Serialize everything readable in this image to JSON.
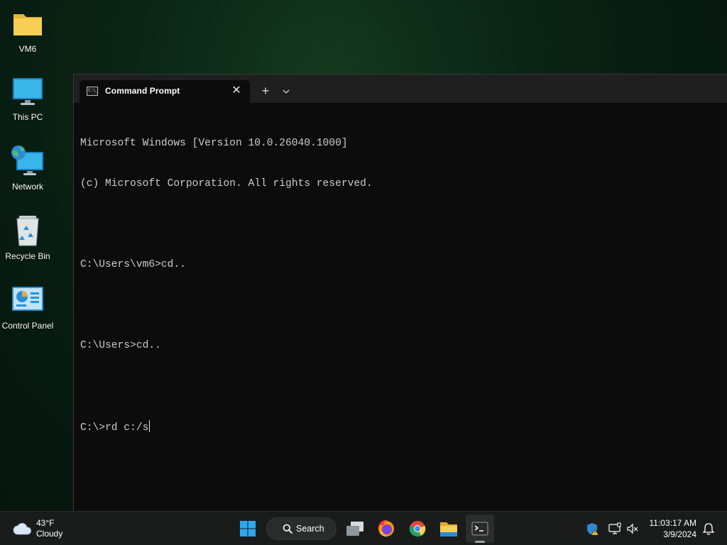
{
  "desktop": {
    "icons": [
      {
        "label": "VM6",
        "icon": "folder-icon"
      },
      {
        "label": "This PC",
        "icon": "computer-icon"
      },
      {
        "label": "Network",
        "icon": "network-icon"
      },
      {
        "label": "Recycle Bin",
        "icon": "recycle-bin-icon"
      },
      {
        "label": "Control Panel",
        "icon": "control-panel-icon"
      }
    ]
  },
  "terminal": {
    "tab_title": "Command Prompt",
    "tab_icon": "cmd-icon",
    "tab_icon_text": "C:\\_",
    "close_glyph": "✕",
    "new_tab_glyph": "+",
    "lines": [
      "Microsoft Windows [Version 10.0.26040.1000]",
      "(c) Microsoft Corporation. All rights reserved.",
      "",
      "C:\\Users\\vm6>cd..",
      "",
      "C:\\Users>cd..",
      "",
      "C:\\>rd c:/s"
    ]
  },
  "taskbar": {
    "weather": {
      "temp": "43°F",
      "condition": "Cloudy",
      "icon": "cloud-icon"
    },
    "search_label": "Search",
    "apps": [
      {
        "name": "start",
        "icon": "windows-logo-icon"
      },
      {
        "name": "task-view",
        "icon": "task-view-icon"
      },
      {
        "name": "firefox",
        "icon": "firefox-icon"
      },
      {
        "name": "chrome",
        "icon": "chrome-icon"
      },
      {
        "name": "file-explorer",
        "icon": "folder-icon"
      },
      {
        "name": "terminal",
        "icon": "terminal-icon",
        "active": true
      }
    ],
    "tray": {
      "security": "shield-warning-icon",
      "display": "display-icon",
      "volume": "volume-muted-icon"
    },
    "clock": {
      "time": "11:03:17 AM",
      "date": "3/9/2024"
    },
    "notification_icon": "bell-icon"
  },
  "colors": {
    "terminal_background": "#0c0c0c",
    "terminal_text": "#cccccc",
    "titlebar": "#1f1f1f",
    "taskbar": "#1a1c1b",
    "desktop_accent": "#0b2415"
  }
}
